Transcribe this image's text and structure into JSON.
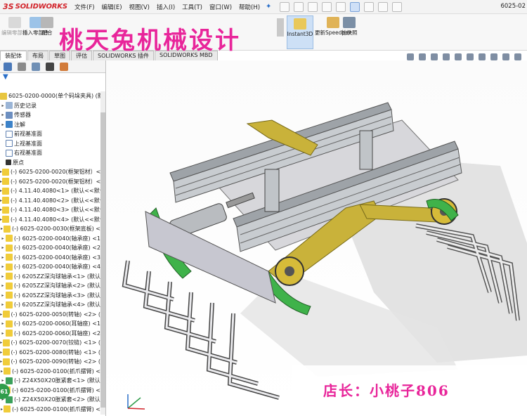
{
  "app": {
    "logo_ds": "3S",
    "logo_text": "SOLIDWORKS",
    "window_title": "6025-02"
  },
  "menu": [
    "文件(F)",
    "编辑(E)",
    "视图(V)",
    "插入(I)",
    "工具(T)",
    "窗口(W)",
    "帮助(H)"
  ],
  "ribbon": {
    "edit_part": "编辑零部件",
    "insert_part": "插入零部件",
    "mate": "配合",
    "instant3d": "Instant3D",
    "speedpak": "更新Speedpak",
    "snapshot": "拍快照"
  },
  "tabs": [
    "装配体",
    "布局",
    "草图",
    "评估",
    "SOLIDWORKS 插件",
    "SOLIDWORKS MBD"
  ],
  "watermark_title": "桃天兔机械设计",
  "tree": {
    "root": "6025-0200-0000(单个码垛夹具) (默认...",
    "items": [
      {
        "label": "历史记录",
        "icon": "folder-icon",
        "type": "fold"
      },
      {
        "label": "传感器",
        "icon": "sensor-icon",
        "type": "sensor"
      },
      {
        "label": "注解",
        "icon": "annotation-icon",
        "type": "note"
      },
      {
        "label": "前视基准面",
        "icon": "plane-icon",
        "type": "plane"
      },
      {
        "label": "上视基准面",
        "icon": "plane-icon",
        "type": "plane"
      },
      {
        "label": "右视基准面",
        "icon": "plane-icon",
        "type": "plane"
      },
      {
        "label": "原点",
        "icon": "origin-icon",
        "type": "origin"
      },
      {
        "label": "(-) 6025-0200-0020(框架铝材）<",
        "icon": "part-icon",
        "type": "part"
      },
      {
        "label": "(-) 6025-0200-0020(框架铝材）<",
        "icon": "part-icon",
        "type": "part"
      },
      {
        "label": "(-) 4.11.40.4080<1> (默认<<默认",
        "icon": "part-icon",
        "type": "part"
      },
      {
        "label": "(-) 4.11.40.4080<2> (默认<<默认",
        "icon": "part-icon",
        "type": "part"
      },
      {
        "label": "(-) 4.11.40.4080<3> (默认<<默认",
        "icon": "part-icon",
        "type": "part"
      },
      {
        "label": "(-) 4.11.40.4080<4> (默认<<默认",
        "icon": "part-icon",
        "type": "part"
      },
      {
        "label": "(-) 6025-0200-0030(框架底板) <",
        "icon": "part-icon",
        "type": "part"
      },
      {
        "label": "(-) 6025-0200-0040(轴承座) <1",
        "icon": "part-icon",
        "type": "part"
      },
      {
        "label": "(-) 6025-0200-0040(轴承座) <2",
        "icon": "part-icon",
        "type": "part"
      },
      {
        "label": "(-) 6025-0200-0040(轴承座) <3",
        "icon": "part-icon",
        "type": "part"
      },
      {
        "label": "(-) 6025-0200-0040(轴承座) <4",
        "icon": "part-icon",
        "type": "part"
      },
      {
        "label": "(-) 6205ZZ深沟球轴承<1> (默认",
        "icon": "part-icon",
        "type": "part"
      },
      {
        "label": "(-) 6205ZZ深沟球轴承<2> (默认",
        "icon": "part-icon",
        "type": "part"
      },
      {
        "label": "(-) 6205ZZ深沟球轴承<3> (默认",
        "icon": "part-icon",
        "type": "part"
      },
      {
        "label": "(-) 6205ZZ深沟球轴承<4> (默认",
        "icon": "part-icon",
        "type": "part"
      },
      {
        "label": "(-) 6025-0200-0050(转轴) <2> (",
        "icon": "part-icon",
        "type": "part"
      },
      {
        "label": "(-) 6025-0200-0060(耳轴座) <1",
        "icon": "part-icon",
        "type": "part"
      },
      {
        "label": "(-) 6025-0200-0060(耳轴座) <2",
        "icon": "part-icon",
        "type": "part"
      },
      {
        "label": "(-) 6025-0200-0070(铰链) <1> (",
        "icon": "part-icon",
        "type": "part"
      },
      {
        "label": "(-) 6025-0200-0080(转轴) <1> (",
        "icon": "part-icon",
        "type": "part"
      },
      {
        "label": "(-) 6025-0200-0090(转轴) <2> (",
        "icon": "part-icon",
        "type": "part"
      },
      {
        "label": "(-) 6025-0200-0100(抓爪摆臂) <",
        "icon": "part-icon",
        "type": "part"
      },
      {
        "label": "(-) Z24X50X20胀紧套<1> (默认",
        "icon": "subassembly-icon",
        "type": "sub"
      },
      {
        "label": "(-) 6025-0200-0100(抓爪摆臂) <",
        "icon": "part-icon",
        "type": "part"
      },
      {
        "label": "(-) Z24X50X20胀紧套<2> (默认",
        "icon": "subassembly-icon",
        "type": "sub"
      },
      {
        "label": "(-) 6025-0200-0100(抓爪摆臂) <",
        "icon": "part-icon",
        "type": "part"
      }
    ]
  },
  "badge_text": "61",
  "shopkeeper": "店长：小桃子806",
  "colors": {
    "accent_pink": "#e8259a",
    "brand_red": "#d2232a",
    "link_blue": "#2a6fc9"
  }
}
